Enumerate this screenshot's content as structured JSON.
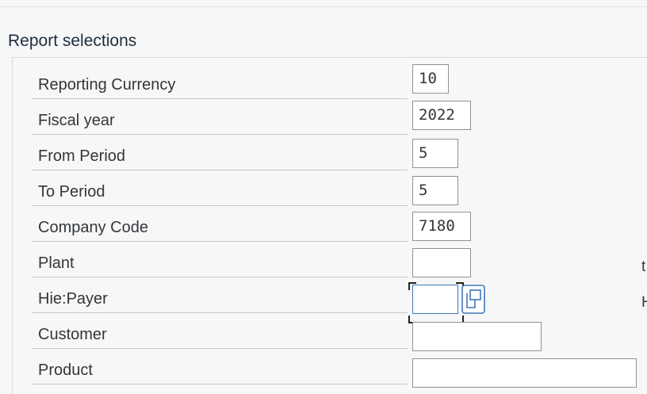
{
  "group": {
    "title": "Report selections"
  },
  "fields": [
    {
      "label": "Reporting Currency",
      "value": "10"
    },
    {
      "label": "Fiscal year",
      "value": "2022"
    },
    {
      "label": "From Period",
      "value": "5"
    },
    {
      "label": "To Period",
      "value": "5"
    },
    {
      "label": "Company Code",
      "value": "7180"
    },
    {
      "label": "Plant",
      "value": ""
    },
    {
      "label": "Hie:Payer",
      "value": ""
    },
    {
      "label": "Customer",
      "value": ""
    },
    {
      "label": "Product",
      "value": ""
    }
  ],
  "edge": {
    "plant_to": "t",
    "payer_to": "H"
  },
  "icons": {
    "hierarchy_help": "hierarchy-value-help-icon"
  },
  "colors": {
    "focus_border": "#3f78b8",
    "field_border": "#9a8a9f"
  }
}
